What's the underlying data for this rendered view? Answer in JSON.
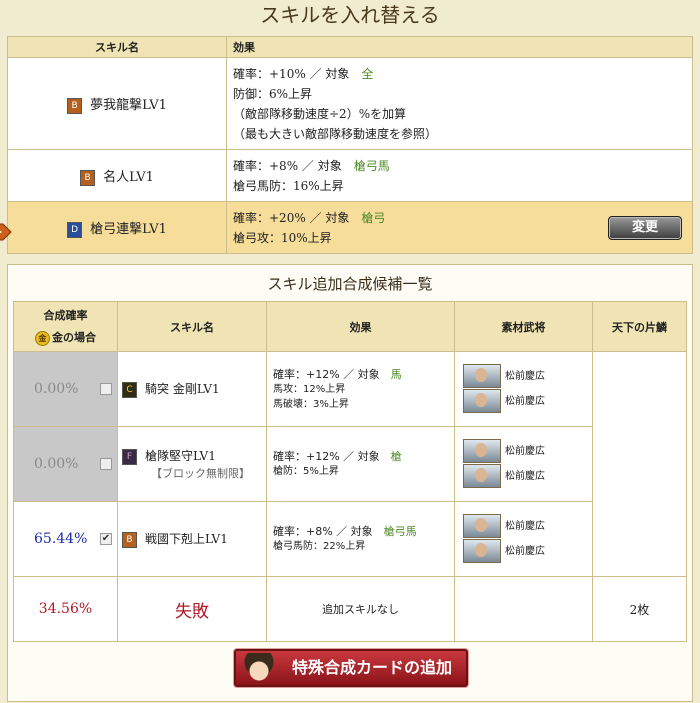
{
  "page": {
    "title": "スキルを入れ替える"
  },
  "current": {
    "headers": {
      "name": "スキル名",
      "effect": "効果"
    },
    "change_label": "変更",
    "rows": [
      {
        "rank": "B",
        "name": "夢我龍撃LV1",
        "target_label": "確率：+10% ／ 対象",
        "target_value": "全",
        "lines": [
          "防御：6%上昇",
          "（敵部隊移動速度÷2）%を加算",
          "（最も大きい敵部隊移動速度を参照）"
        ]
      },
      {
        "rank": "B",
        "name": "名人LV1",
        "target_label": "確率：+8% ／ 対象",
        "target_value": "槍弓馬",
        "lines": [
          "槍弓馬防：16%上昇"
        ]
      },
      {
        "rank": "D",
        "name": "槍弓連撃LV1",
        "target_label": "確率：+20% ／ 対象",
        "target_value": "槍弓",
        "lines": [
          "槍弓攻：10%上昇"
        ],
        "selected": true
      }
    ]
  },
  "candidates": {
    "title": "スキル追加合成候補一覧",
    "headers": {
      "rate": "合成確率",
      "gold": "金",
      "gold_case": "金の場合",
      "name": "スキル名",
      "effect": "効果",
      "material": "素材武将",
      "tenka": "天下の片鱗"
    },
    "rows": [
      {
        "rate": "0.00%",
        "checked": false,
        "rank": "C",
        "name": "騎突 金剛LV1",
        "sub": "",
        "target_label": "確率：+12% ／ 対象",
        "target_value": "馬",
        "lines": [
          "馬攻：12%上昇",
          "馬破壊：3%上昇"
        ],
        "materials": [
          "松前慶広",
          "松前慶広"
        ]
      },
      {
        "rate": "0.00%",
        "checked": false,
        "rank": "F",
        "name": "槍隊堅守LV1",
        "sub": "【ブロック無制限】",
        "target_label": "確率：+12% ／ 対象",
        "target_value": "槍",
        "lines": [
          "槍防：5%上昇"
        ],
        "materials": [
          "松前慶広",
          "松前慶広"
        ]
      },
      {
        "rate": "65.44%",
        "checked": true,
        "rank": "B",
        "name": "戦國下剋上LV1",
        "sub": "",
        "target_label": "確率：+8% ／ 対象",
        "target_value": "槍弓馬",
        "lines": [
          "槍弓馬防：22%上昇"
        ],
        "materials": [
          "松前慶広",
          "松前慶広"
        ]
      }
    ],
    "fail": {
      "rate": "34.56%",
      "label": "失敗",
      "effect": "追加スキルなし",
      "tenka": "2枚"
    },
    "checkmark": "✔",
    "special_button": "特殊合成カードの追加"
  },
  "colors": {
    "accent_green": "#4c8a25",
    "active_rate": "#1d2ea8",
    "fail_red": "#b0192a",
    "selected_row": "#f7dd9a"
  }
}
